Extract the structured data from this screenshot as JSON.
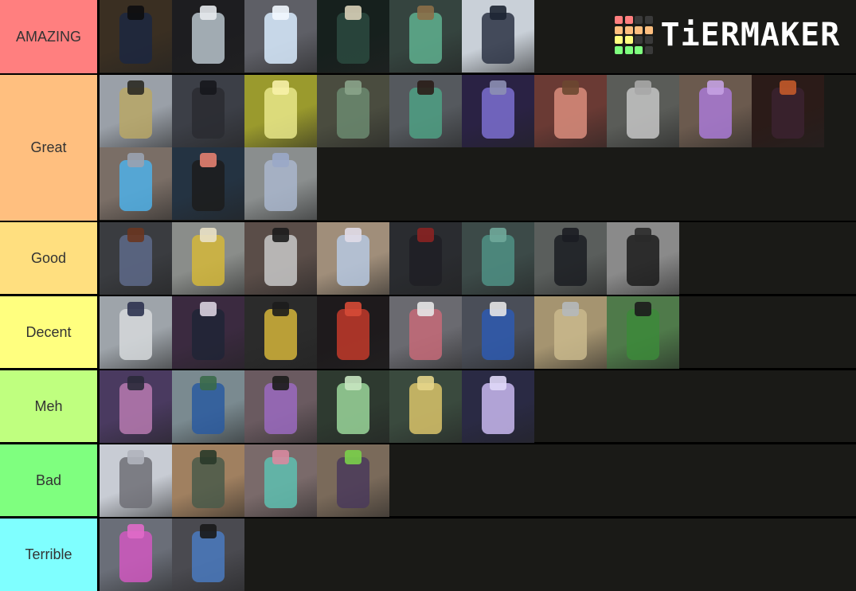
{
  "brand": {
    "name": "TiERMAKER",
    "grid_colors": [
      "#ff7f7f",
      "#ff7f7f",
      "#3a3a3a",
      "#3a3a3a",
      "#ffbf7f",
      "#ffbf7f",
      "#ffbf7f",
      "#ffbf7f",
      "#ffff7f",
      "#ffff7f",
      "#3a3a3a",
      "#3a3a3a",
      "#7fff7f",
      "#7fff7f",
      "#7fff7f",
      "#3a3a3a"
    ]
  },
  "tiers": [
    {
      "label": "AMAZING",
      "color": "#ff7f7f",
      "items": [
        {
          "name": "dark-navy-stand",
          "bg": "#3a2f22",
          "fg": "#1c2740",
          "head": "#0d0d10"
        },
        {
          "name": "white-armored-stand",
          "bg": "#1d1d20",
          "fg": "#b9c4cc",
          "head": "#e6e9ec"
        },
        {
          "name": "glowing-white-stand",
          "bg": "#5e5f66",
          "fg": "#d9ecff",
          "head": "#f2f8ff"
        },
        {
          "name": "green-dark-stand",
          "bg": "#16201d",
          "fg": "#2b4a40",
          "head": "#d8d0b8"
        },
        {
          "name": "teal-orange-stand",
          "bg": "#35443f",
          "fg": "#5fb08f",
          "head": "#8b6f48"
        },
        {
          "name": "sword-wielder",
          "bg": "#c9d0d8",
          "fg": "#2c3344",
          "head": "#1d2533"
        }
      ]
    },
    {
      "label": "Great",
      "color": "#ffbf7f",
      "items": [
        {
          "name": "gold-star-stand",
          "bg": "#9aa0a8",
          "fg": "#b8a766",
          "head": "#2b2a22"
        },
        {
          "name": "black-armored-stand",
          "bg": "#3c3f47",
          "fg": "#2a2b31",
          "head": "#16171c"
        },
        {
          "name": "yellow-glow-stand",
          "bg": "#9a9a2d",
          "fg": "#e7e68a",
          "head": "#f7f1a8"
        },
        {
          "name": "green-muscle-stand",
          "bg": "#4a4c3f",
          "fg": "#6b8a70",
          "head": "#8aa38a"
        },
        {
          "name": "teal-brown-stand",
          "bg": "#55595e",
          "fg": "#4fa084",
          "head": "#2a1d18"
        },
        {
          "name": "purple-dark-stand",
          "bg": "#2a2244",
          "fg": "#7b6fd0",
          "head": "#8c8fb4"
        },
        {
          "name": "pink-gloved-stand",
          "bg": "#6a3a34",
          "fg": "#d98d7c",
          "head": "#6b4730"
        },
        {
          "name": "grey-armor-stand",
          "bg": "#5a5c58",
          "fg": "#c6c6c6",
          "head": "#a7a7a7"
        },
        {
          "name": "purple-diamond-stand",
          "bg": "#6b5a4e",
          "fg": "#a97ad6",
          "head": "#c4a1e2"
        },
        {
          "name": "black-orange-stand",
          "bg": "#2b1b18",
          "fg": "#3b2230",
          "head": "#c35a2a"
        },
        {
          "name": "blue-muscle-stand",
          "bg": "#7a6e66",
          "fg": "#4fb0e8",
          "head": "#9aa2b0"
        },
        {
          "name": "pistol-item",
          "bg": "#243342",
          "fg": "#1c1c1c",
          "head": "#e48070"
        },
        {
          "name": "silver-knight-stand",
          "bg": "#8a8e8e",
          "fg": "#a9b6cc",
          "head": "#9aa8c8"
        }
      ]
    },
    {
      "label": "Good",
      "color": "#ffdf7f",
      "items": [
        {
          "name": "redhead-character",
          "bg": "#3a3c40",
          "fg": "#5e6a8a",
          "head": "#6a3520"
        },
        {
          "name": "gold-suit-character",
          "bg": "#8a8d8a",
          "fg": "#d4b73a",
          "head": "#e9e1c5"
        },
        {
          "name": "checkered-stand",
          "bg": "#5a4d48",
          "fg": "#c8c8c8",
          "head": "#1c1c1c"
        },
        {
          "name": "pastel-stand",
          "bg": "#a08e7a",
          "fg": "#b6c8e0",
          "head": "#e0dce8"
        },
        {
          "name": "black-coat-character",
          "bg": "#2a2c30",
          "fg": "#1e1f24",
          "head": "#8a2222"
        },
        {
          "name": "green-scale-stand",
          "bg": "#3c4a48",
          "fg": "#4f9085",
          "head": "#6fa89a"
        },
        {
          "name": "katana-character",
          "bg": "#5a5e5c",
          "fg": "#1b1d22",
          "head": "#1b1d22"
        },
        {
          "name": "dark-room-swordsman",
          "bg": "#8a8a8a",
          "fg": "#1b1b1b",
          "head": "#2a2a2a"
        }
      ]
    },
    {
      "label": "Decent",
      "color": "#ffff7f",
      "items": [
        {
          "name": "white-gold-stand",
          "bg": "#9ea4aa",
          "fg": "#d6d9dc",
          "head": "#2d3350"
        },
        {
          "name": "dark-hat-stand",
          "bg": "#3b2a40",
          "fg": "#202536",
          "head": "#d9d0de"
        },
        {
          "name": "antler-stand",
          "bg": "#2b2b2b",
          "fg": "#d4b43a",
          "head": "#1c1c1c"
        },
        {
          "name": "red-stand",
          "bg": "#1e1a1c",
          "fg": "#c23a2a",
          "head": "#d54a36"
        },
        {
          "name": "pink-check-stand",
          "bg": "#6a6a70",
          "fg": "#c66a78",
          "head": "#e6e6e6"
        },
        {
          "name": "blue-white-stand",
          "bg": "#4a4e58",
          "fg": "#2e5bb0",
          "head": "#e6e6e6"
        },
        {
          "name": "tan-pistol-item",
          "bg": "#a59470",
          "fg": "#c9b88c",
          "head": "#b5b8bb"
        },
        {
          "name": "green-star-character",
          "bg": "#4f7a4a",
          "fg": "#3c8a3a",
          "head": "#1c1c1c"
        }
      ]
    },
    {
      "label": "Meh",
      "color": "#bfff7f",
      "items": [
        {
          "name": "purple-capped-character",
          "bg": "#4a3a60",
          "fg": "#b77ab0",
          "head": "#2a2a3a"
        },
        {
          "name": "blue-coat-stand",
          "bg": "#7a8a90",
          "fg": "#2a5aa0",
          "head": "#3a6a4a"
        },
        {
          "name": "purple-gold-stand",
          "bg": "#6a5a60",
          "fg": "#9a6ac0",
          "head": "#1c1c1c"
        },
        {
          "name": "green-glow-stand",
          "bg": "#2e3a30",
          "fg": "#9ad69a",
          "head": "#c6e6c0"
        },
        {
          "name": "gold-green-glow-stand",
          "bg": "#3a4a3e",
          "fg": "#d9c36a",
          "head": "#e6d68a"
        },
        {
          "name": "lavender-stand",
          "bg": "#2a2a44",
          "fg": "#c9b8f0",
          "head": "#e0d8f8"
        }
      ]
    },
    {
      "label": "Bad",
      "color": "#7fff7f",
      "items": [
        {
          "name": "armadillo-stand",
          "bg": "#c8ccd4",
          "fg": "#6e6e76",
          "head": "#b0b4bc"
        },
        {
          "name": "small-spiky-stand",
          "bg": "#a08060",
          "fg": "#4a5a4a",
          "head": "#2a3a2a"
        },
        {
          "name": "teal-pink-stand",
          "bg": "#7a6a6a",
          "fg": "#5ec0b0",
          "head": "#d88aa0"
        },
        {
          "name": "purple-green-doorway-stand",
          "bg": "#7a6a5a",
          "fg": "#4a3a5a",
          "head": "#7ad04a"
        }
      ]
    },
    {
      "label": "Terrible",
      "color": "#7fffff",
      "items": [
        {
          "name": "magenta-stand",
          "bg": "#6a6e78",
          "fg": "#d058c0",
          "head": "#e06ac8"
        },
        {
          "name": "blue-black-gold-stand",
          "bg": "#4a4a50",
          "fg": "#4a7ac0",
          "head": "#1a1a1a"
        }
      ]
    }
  ]
}
